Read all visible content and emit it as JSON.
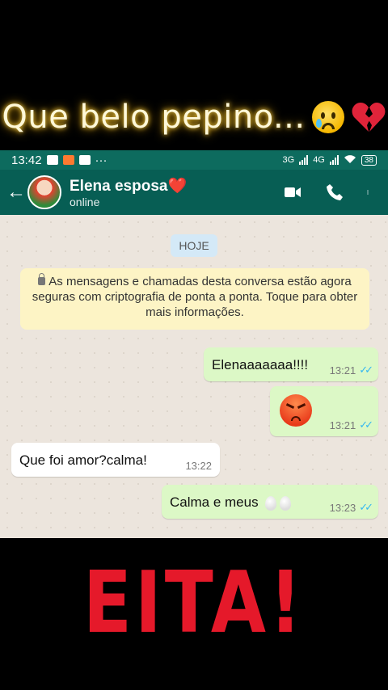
{
  "overlay": {
    "top_caption": "Que belo pepino...",
    "bottom_caption": "EITA!"
  },
  "status_bar": {
    "time": "13:42",
    "more": "···",
    "network1": "3G",
    "network2": "4G",
    "battery": "38"
  },
  "header": {
    "contact_name": "Elena esposa❤️",
    "contact_status": "online"
  },
  "chat": {
    "date_chip": "HOJE",
    "encryption_notice": "As mensagens e chamadas desta conversa estão agora seguras com criptografia de ponta a ponta. Toque para obter mais informações.",
    "messages": [
      {
        "direction": "out",
        "text": "Elenaaaaaaa!!!!",
        "time": "13:21",
        "status": "read"
      },
      {
        "direction": "out",
        "text": "",
        "emoji": "angry-face",
        "time": "13:21",
        "status": "read"
      },
      {
        "direction": "in",
        "text": "Que foi amor?calma!",
        "time": "13:22"
      },
      {
        "direction": "out",
        "text": "Calma e meus",
        "emoji": "eggs",
        "time": "13:23",
        "status": "read"
      }
    ]
  },
  "colors": {
    "header": "#075e54",
    "status_bar": "#0d6b5e",
    "outgoing_bubble": "#dcf8c6",
    "incoming_bubble": "#ffffff",
    "read_ticks": "#34b7f1",
    "bottom_caption": "#e5192a"
  }
}
